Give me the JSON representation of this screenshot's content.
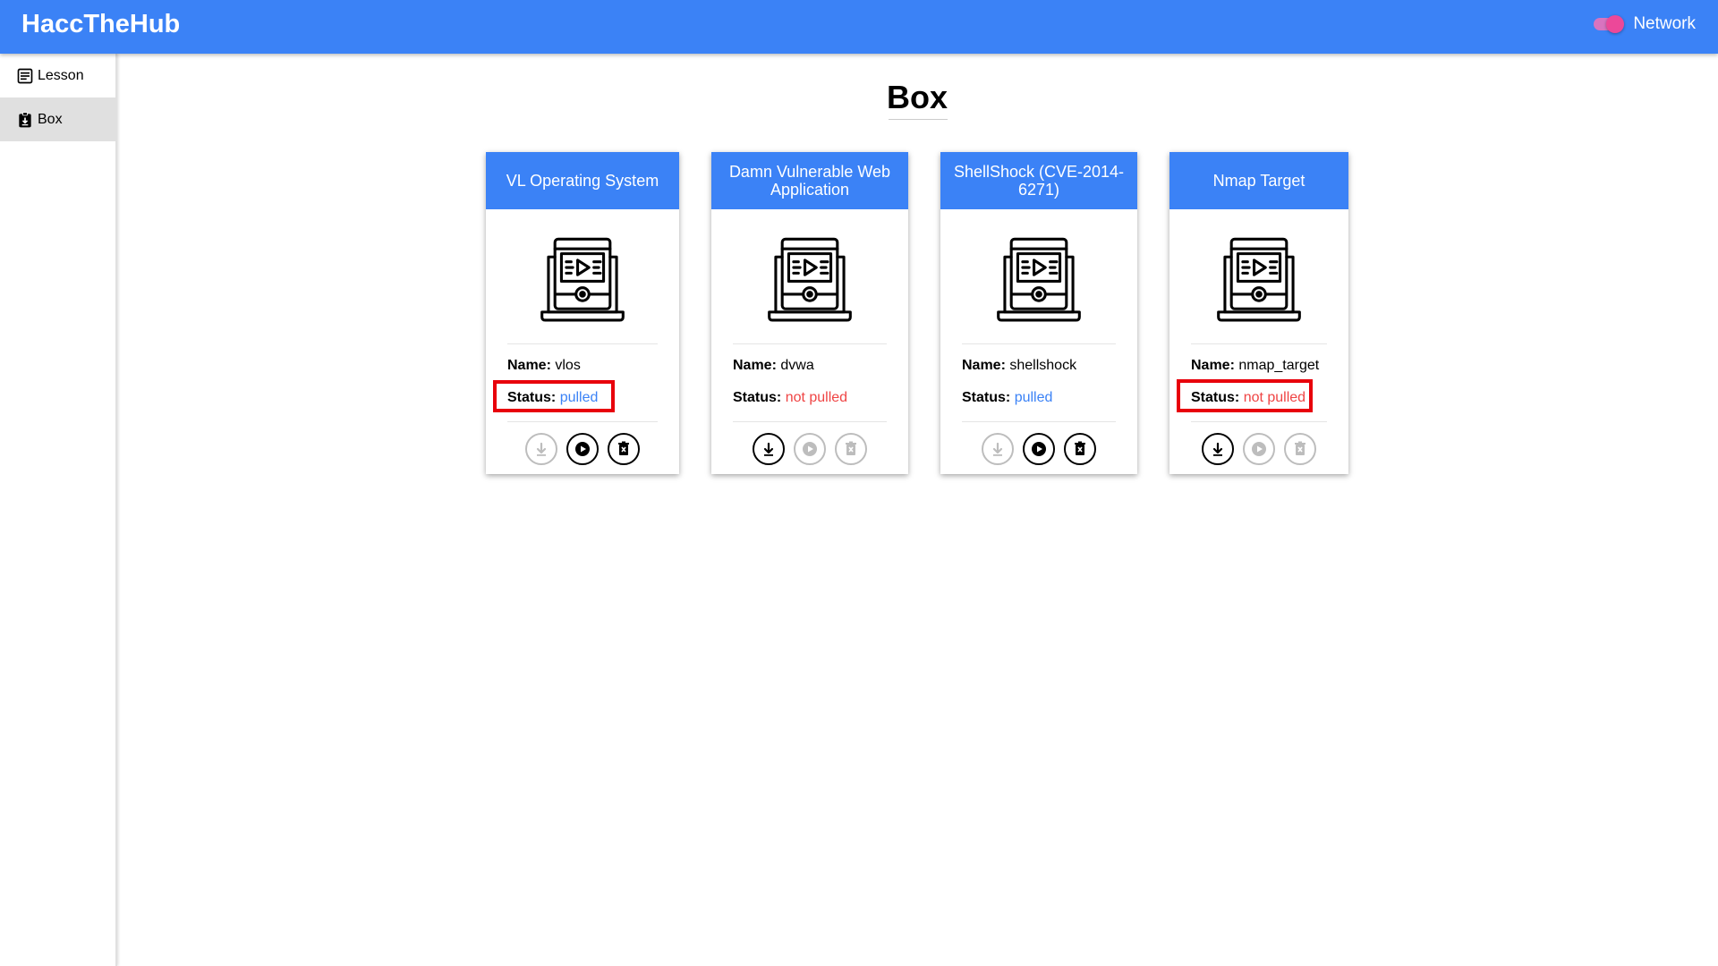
{
  "app": {
    "title": "HaccTheHub"
  },
  "network": {
    "label": "Network",
    "enabled": true
  },
  "sidebar": {
    "items": [
      {
        "label": "Lesson",
        "icon": "lesson-icon",
        "active": false
      },
      {
        "label": "Box",
        "icon": "box-icon",
        "active": true
      }
    ]
  },
  "page": {
    "title": "Box"
  },
  "colors": {
    "accent": "#3b82f6",
    "pulled": "#3b82f6",
    "not_pulled": "#ef4444",
    "toggle": "#ec4899",
    "highlight": "#e8000b"
  },
  "labels": {
    "name": "Name:",
    "status": "Status:"
  },
  "cards": [
    {
      "title": "VL Operating System",
      "name": "vlos",
      "status": "pulled",
      "icon": "video-laptop-icon",
      "pull_enabled": false,
      "run_enabled": true,
      "delete_enabled": true,
      "highlighted": true
    },
    {
      "title": "Damn Vulnerable Web Application",
      "name": "dvwa",
      "status": "not pulled",
      "icon": "video-laptop-icon",
      "pull_enabled": true,
      "run_enabled": false,
      "delete_enabled": false,
      "highlighted": false
    },
    {
      "title": "ShellShock (CVE-2014-6271)",
      "name": "shellshock",
      "status": "pulled",
      "icon": "video-laptop-icon",
      "pull_enabled": false,
      "run_enabled": true,
      "delete_enabled": true,
      "highlighted": false
    },
    {
      "title": "Nmap Target",
      "name": "nmap_target",
      "status": "not pulled",
      "icon": "video-laptop-icon",
      "pull_enabled": true,
      "run_enabled": false,
      "delete_enabled": false,
      "highlighted": true
    }
  ]
}
